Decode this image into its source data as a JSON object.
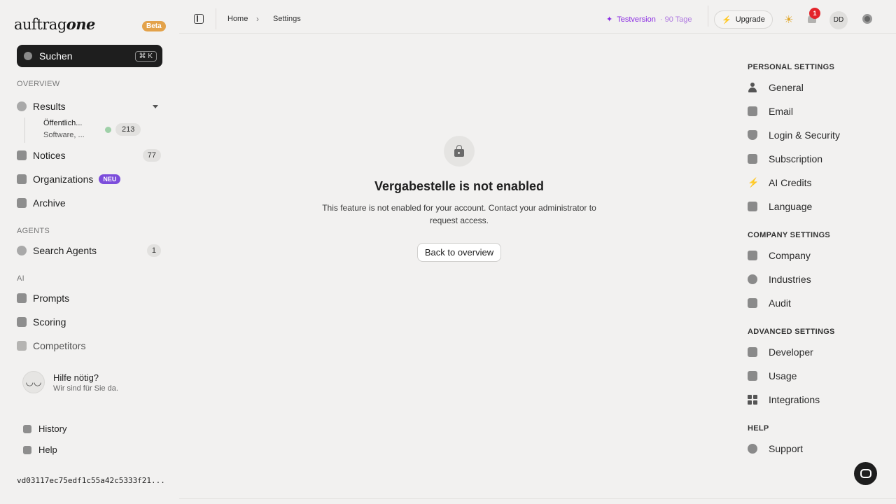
{
  "sidebar": {
    "logo_main": "auftrag",
    "logo_accent": "one",
    "beta": "Beta",
    "search_label": "Suchen",
    "search_shortcut": "⌘ K",
    "sections": {
      "overview": "OVERVIEW",
      "agents": "AGENTS",
      "ai": "AI"
    },
    "results": {
      "label": "Results",
      "sub_line1": "Öffentlich...",
      "sub_line2": "Software, ...",
      "sub_count": "213"
    },
    "notices": {
      "label": "Notices",
      "count": "77"
    },
    "organizations": {
      "label": "Organizations",
      "badge": "NEU"
    },
    "archive": {
      "label": "Archive"
    },
    "search_agents": {
      "label": "Search Agents",
      "count": "1"
    },
    "prompts": {
      "label": "Prompts"
    },
    "scoring": {
      "label": "Scoring"
    },
    "competitors": {
      "label": "Competitors"
    },
    "help_box": {
      "title": "Hilfe nötig?",
      "subtitle": "Wir sind für Sie da."
    },
    "history": "History",
    "help": "Help",
    "version": "vd03117ec75edf1c55a42c5333f21..."
  },
  "header": {
    "breadcrumb": [
      "Home",
      "Settings"
    ],
    "breadcrumb_sep": "›",
    "trial_label": "Testversion",
    "trial_days": "· 90 Tage",
    "upgrade_label": "Upgrade",
    "notification_count": "1",
    "avatar_initials": "DD"
  },
  "main": {
    "title": "Vergabestelle is not enabled",
    "description": "This feature is not enabled for your account. Contact your administrator to request access.",
    "back_button": "Back to overview"
  },
  "settings_nav": {
    "personal_title": "PERSONAL SETTINGS",
    "general": "General",
    "email": "Email",
    "login_security": "Login & Security",
    "subscription": "Subscription",
    "ai_credits": "AI Credits",
    "language": "Language",
    "company_title": "COMPANY SETTINGS",
    "company": "Company",
    "industries": "Industries",
    "audit": "Audit",
    "advanced_title": "ADVANCED SETTINGS",
    "developer": "Developer",
    "usage": "Usage",
    "integrations": "Integrations",
    "help_title": "HELP",
    "support": "Support"
  }
}
